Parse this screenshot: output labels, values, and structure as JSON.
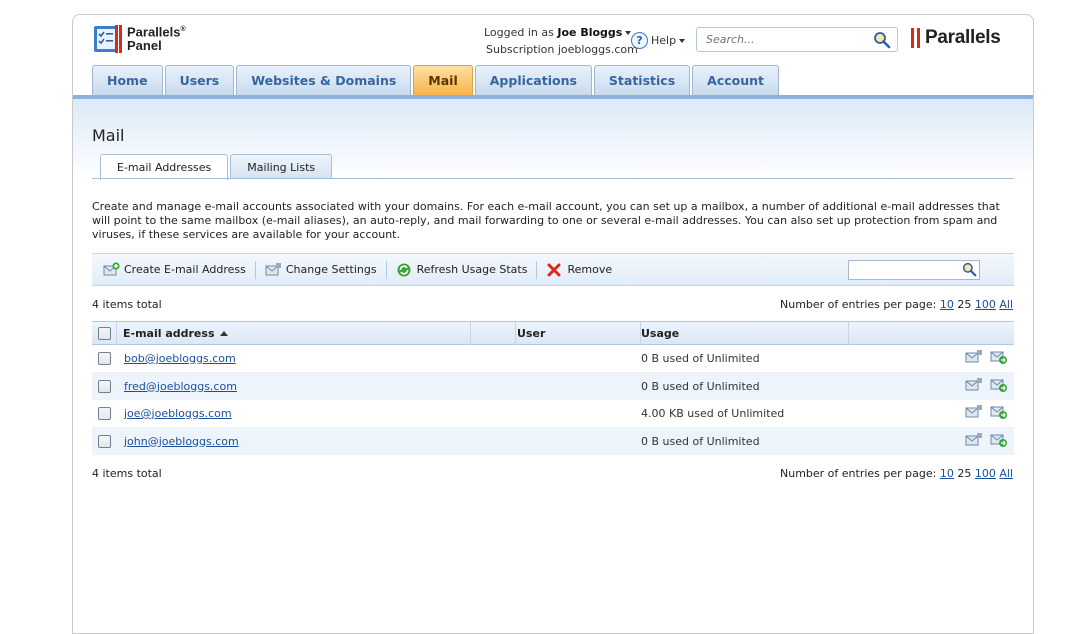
{
  "header": {
    "logo_line1": "Parallels",
    "logo_mark": "®",
    "logo_line2": "Panel",
    "logged_in_prefix": "Logged in as",
    "user_name": "Joe Bloggs",
    "subscription_prefix": "Subscription",
    "subscription_name": "joebloggs.com",
    "help_label": "Help",
    "search_placeholder": "Search...",
    "brand": "Parallels"
  },
  "nav": {
    "tabs": [
      {
        "label": "Home"
      },
      {
        "label": "Users"
      },
      {
        "label": "Websites & Domains"
      },
      {
        "label": "Mail"
      },
      {
        "label": "Applications"
      },
      {
        "label": "Statistics"
      },
      {
        "label": "Account"
      }
    ],
    "active_index": 3
  },
  "page": {
    "title": "Mail",
    "subtabs": [
      {
        "label": "E-mail Addresses"
      },
      {
        "label": "Mailing Lists"
      }
    ],
    "description": "Create and manage e-mail accounts associated with your domains. For each e-mail account, you can set up a mailbox, a number of additional e-mail addresses that will point to the same mailbox (e-mail aliases), an auto-reply, and mail forwarding to one or several e-mail addresses. You can also set up protection from spam and viruses, if these services are available for your account."
  },
  "toolbar": {
    "create_label": "Create E-mail Address",
    "change_label": "Change Settings",
    "refresh_label": "Refresh Usage Stats",
    "remove_label": "Remove"
  },
  "list": {
    "total_label": "4 items total",
    "per_page_label": "Number of entries per page:",
    "per_page_10": "10",
    "per_page_25": "25",
    "per_page_100": "100",
    "per_page_all": "All",
    "columns": {
      "email": "E-mail address",
      "user": "User",
      "usage": "Usage"
    },
    "rows": [
      {
        "email": "bob@joebloggs.com",
        "usage": "0 B used of Unlimited"
      },
      {
        "email": "fred@joebloggs.com",
        "usage": "0 B used of Unlimited"
      },
      {
        "email": "joe@joebloggs.com",
        "usage": "4.00 KB used of Unlimited"
      },
      {
        "email": "john@joebloggs.com",
        "usage": "0 B used of Unlimited"
      }
    ]
  },
  "colors": {
    "nav_active": "#f6b54a",
    "link": "#1a4f9c",
    "brand_red": "#d52b1e"
  }
}
